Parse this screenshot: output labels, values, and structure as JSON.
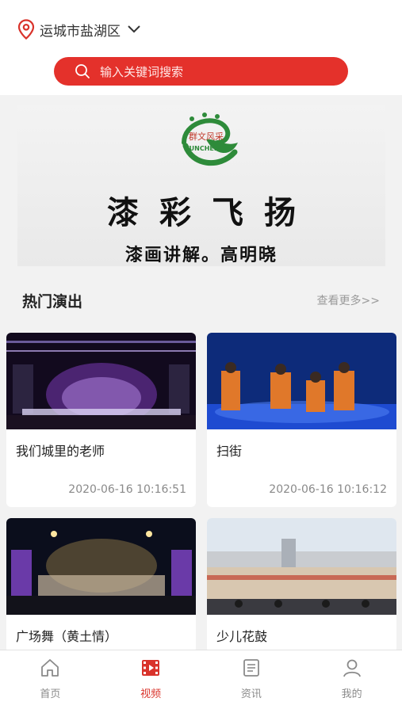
{
  "header": {
    "location": "运城市盐湖区",
    "search_placeholder": "输入关键词搜索"
  },
  "banner": {
    "logo_text_top": "群文风采",
    "logo_text_bottom": "YUNCHENG",
    "title": "漆彩飞扬",
    "subtitle": "漆画讲解。高明晓"
  },
  "section": {
    "title": "热门演出",
    "more": "查看更多>>"
  },
  "cards": [
    {
      "title": "我们城里的老师",
      "time": "2020-06-16 10:16:51"
    },
    {
      "title": "扫街",
      "time": "2020-06-16 10:16:12"
    },
    {
      "title": "广场舞（黄土情）",
      "time": ""
    },
    {
      "title": "少儿花鼓",
      "time": ""
    }
  ],
  "tabs": [
    {
      "label": "首页",
      "icon": "home-icon",
      "active": false
    },
    {
      "label": "视频",
      "icon": "video-icon",
      "active": true
    },
    {
      "label": "资讯",
      "icon": "news-icon",
      "active": false
    },
    {
      "label": "我的",
      "icon": "user-icon",
      "active": false
    }
  ],
  "colors": {
    "accent": "#e4312b",
    "tab_active": "#d9332b"
  }
}
